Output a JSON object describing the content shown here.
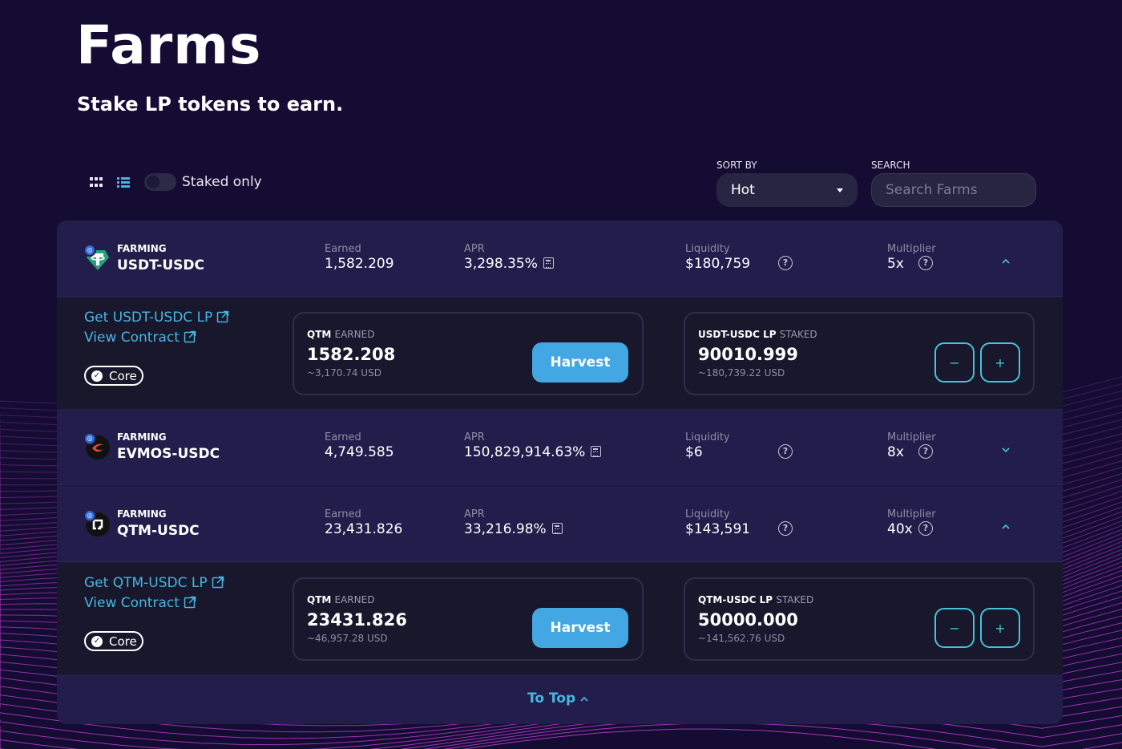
{
  "header": {
    "title": "Farms",
    "subtitle": "Stake LP tokens to earn."
  },
  "controls": {
    "staked_only_label": "Staked only",
    "staked_only": false,
    "view_mode": "list",
    "sort_label": "SORT BY",
    "sort_value": "Hot",
    "search_label": "SEARCH",
    "search_placeholder": "Search Farms"
  },
  "colors": {
    "background": "#150c33",
    "accent": "#42a7e3",
    "link": "#47b6e0",
    "wave": "#c13fd6"
  },
  "column_labels": {
    "earned": "Earned",
    "apr": "APR",
    "liquidity": "Liquidity",
    "multiplier": "Multiplier"
  },
  "farms": [
    {
      "farming_label": "FARMING",
      "pair": "USDT-USDC",
      "icon": "tether-icon",
      "earned": "1,582.209",
      "apr": "3,298.35%",
      "liquidity": "$180,759",
      "multiplier": "5x",
      "expanded": true,
      "details": {
        "get_lp_label": "Get USDT-USDC LP",
        "view_contract_label": "View Contract",
        "core_label": "Core",
        "earned_token": "QTM",
        "earned_suffix": "EARNED",
        "earned_amount": "1582.208",
        "earned_usd": "~3,170.74 USD",
        "harvest_label": "Harvest",
        "staked_token": "USDT-USDC LP",
        "staked_suffix": "STAKED",
        "staked_amount": "90010.999",
        "staked_usd": "~180,739.22 USD",
        "minus_label": "−",
        "plus_label": "+"
      }
    },
    {
      "farming_label": "FARMING",
      "pair": "EVMOS-USDC",
      "icon": "evmos-icon",
      "earned": "4,749.585",
      "apr": "150,829,914.63%",
      "liquidity": "$6",
      "multiplier": "8x",
      "expanded": false
    },
    {
      "farming_label": "FARMING",
      "pair": "QTM-USDC",
      "icon": "qtm-icon",
      "earned": "23,431.826",
      "apr": "33,216.98%",
      "liquidity": "$143,591",
      "multiplier": "40x",
      "expanded": true,
      "details": {
        "get_lp_label": "Get QTM-USDC LP",
        "view_contract_label": "View Contract",
        "core_label": "Core",
        "earned_token": "QTM",
        "earned_suffix": "EARNED",
        "earned_amount": "23431.826",
        "earned_usd": "~46,957.28 USD",
        "harvest_label": "Harvest",
        "staked_token": "QTM-USDC LP",
        "staked_suffix": "STAKED",
        "staked_amount": "50000.000",
        "staked_usd": "~141,562.76 USD",
        "minus_label": "−",
        "plus_label": "+"
      }
    }
  ],
  "footer": {
    "to_top_label": "To Top"
  }
}
